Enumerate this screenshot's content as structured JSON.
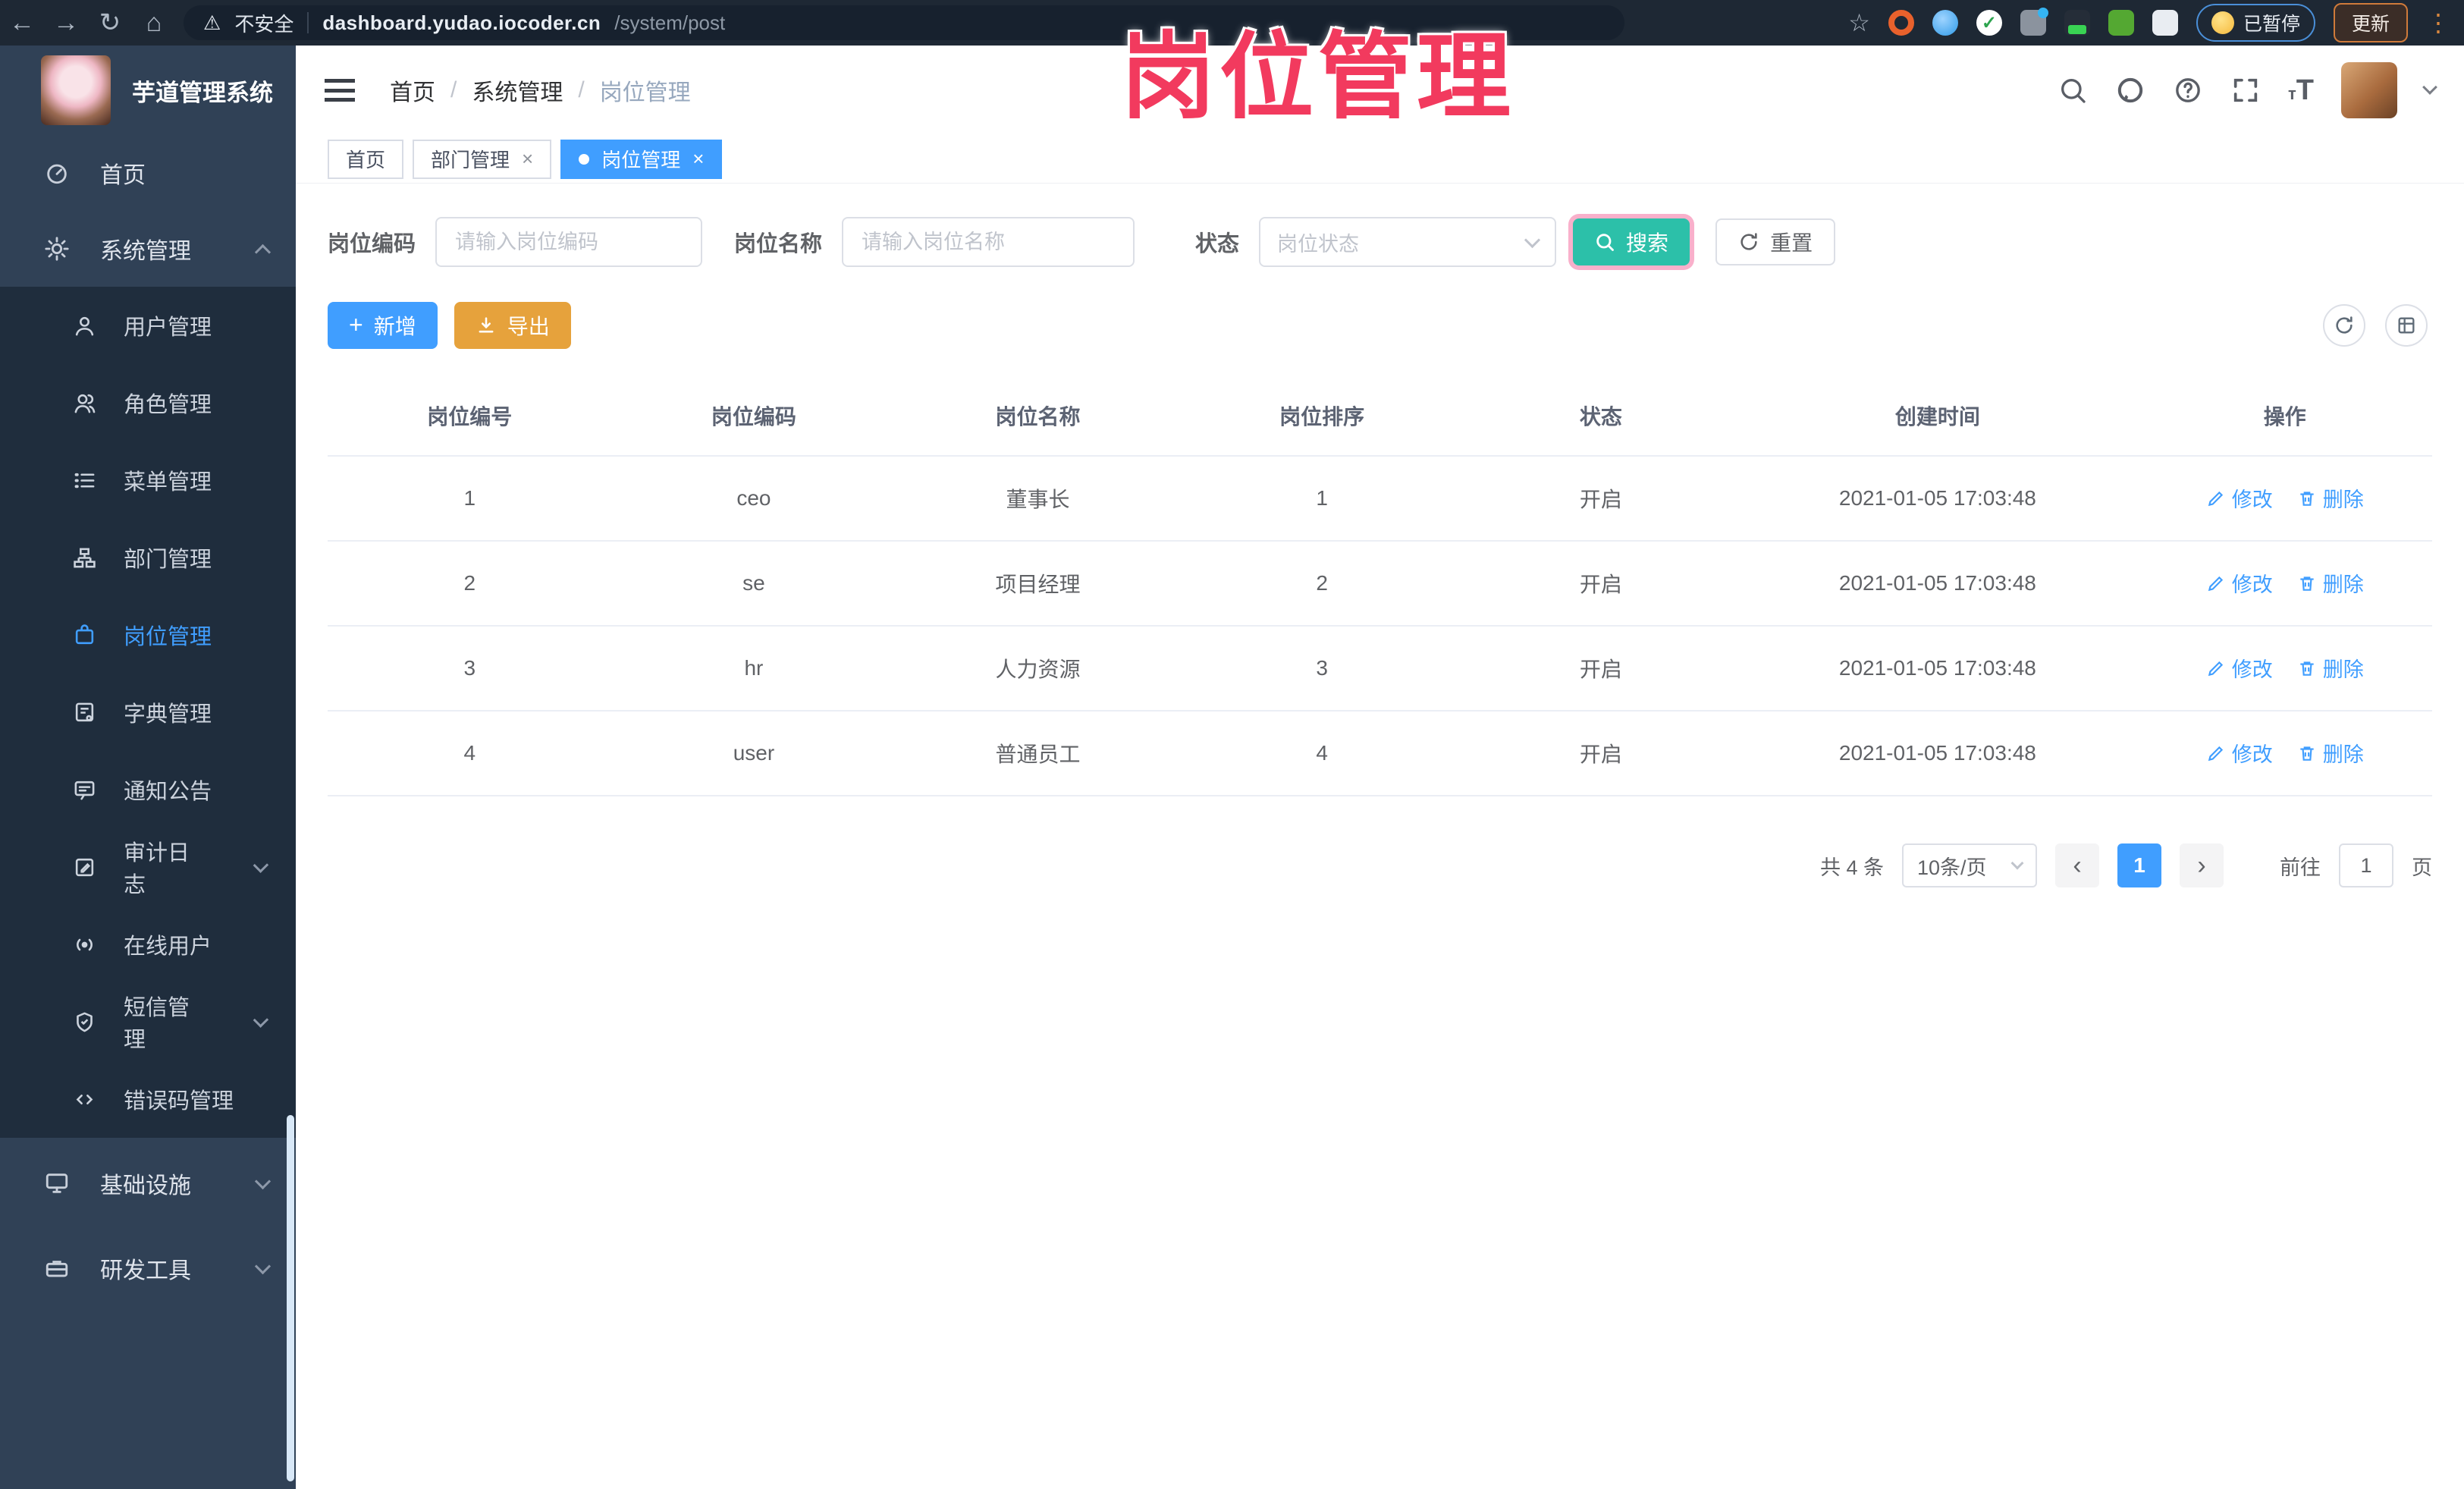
{
  "browser": {
    "security_label": "不安全",
    "url_host": "dashboard.yudao.iocoder.cn",
    "url_path": "/system/post",
    "paused_label": "已暂停",
    "update_label": "更新"
  },
  "watermark": "岗位管理",
  "sidebar": {
    "title": "芋道管理系统",
    "items": [
      {
        "label": "首页"
      },
      {
        "label": "系统管理"
      },
      {
        "label": "用户管理"
      },
      {
        "label": "角色管理"
      },
      {
        "label": "菜单管理"
      },
      {
        "label": "部门管理"
      },
      {
        "label": "岗位管理"
      },
      {
        "label": "字典管理"
      },
      {
        "label": "通知公告"
      },
      {
        "label": "审计日志"
      },
      {
        "label": "在线用户"
      },
      {
        "label": "短信管理"
      },
      {
        "label": "错误码管理"
      },
      {
        "label": "基础设施"
      },
      {
        "label": "研发工具"
      }
    ]
  },
  "header": {
    "breadcrumb": {
      "home": "首页",
      "section": "系统管理",
      "current": "岗位管理",
      "separator": "/"
    }
  },
  "tabs": [
    {
      "label": "首页"
    },
    {
      "label": "部门管理"
    },
    {
      "label": "岗位管理"
    }
  ],
  "filters": {
    "code_label": "岗位编码",
    "code_placeholder": "请输入岗位编码",
    "name_label": "岗位名称",
    "name_placeholder": "请输入岗位名称",
    "status_label": "状态",
    "status_placeholder": "岗位状态",
    "search_label": "搜索",
    "reset_label": "重置"
  },
  "toolbar": {
    "add_label": "新增",
    "export_label": "导出"
  },
  "table": {
    "headers": [
      "岗位编号",
      "岗位编码",
      "岗位名称",
      "岗位排序",
      "状态",
      "创建时间",
      "操作"
    ],
    "edit_label": "修改",
    "delete_label": "删除",
    "rows": [
      {
        "cells": [
          "1",
          "ceo",
          "董事长",
          "1",
          "开启",
          "2021-01-05 17:03:48"
        ]
      },
      {
        "cells": [
          "2",
          "se",
          "项目经理",
          "2",
          "开启",
          "2021-01-05 17:03:48"
        ]
      },
      {
        "cells": [
          "3",
          "hr",
          "人力资源",
          "3",
          "开启",
          "2021-01-05 17:03:48"
        ]
      },
      {
        "cells": [
          "4",
          "user",
          "普通员工",
          "4",
          "开启",
          "2021-01-05 17:03:48"
        ]
      }
    ]
  },
  "pagination": {
    "total_text": "共 4 条",
    "page_size": "10条/页",
    "current_page": "1",
    "goto_label": "前往",
    "goto_value": "1",
    "page_unit": "页"
  },
  "colors": {
    "accent": "#409EFF",
    "search_button": "#2cc0a9",
    "export_button": "#E6A23C",
    "watermark": "#f23a5e",
    "sidebar_bg": "#304156",
    "submenu_bg": "#1f2d3d"
  }
}
